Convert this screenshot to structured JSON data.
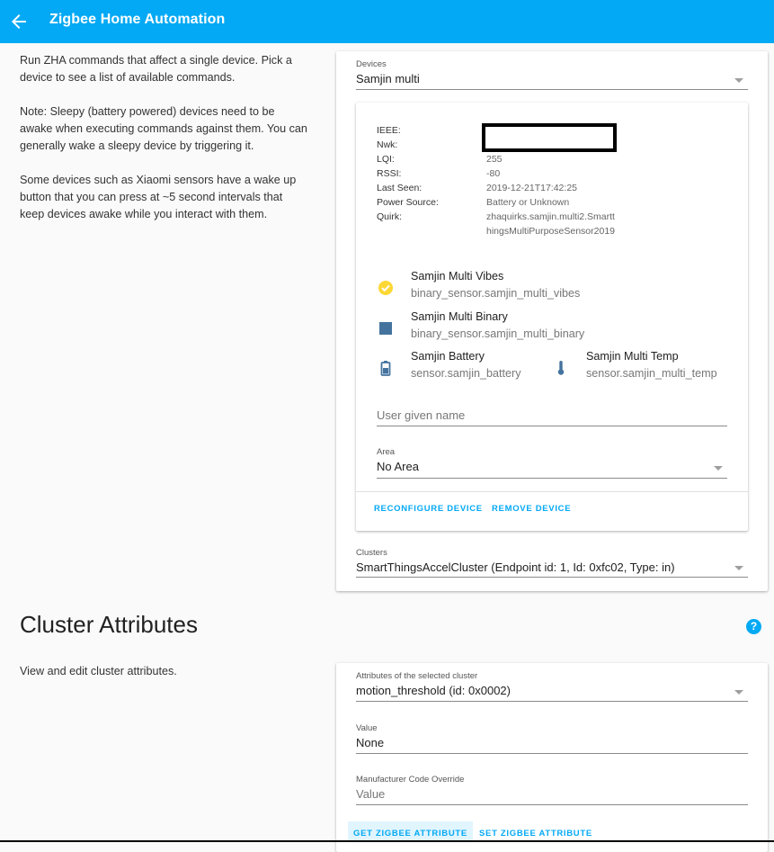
{
  "app": {
    "title": "Zigbee Home Automation",
    "accent": "#03a9f4"
  },
  "intro": {
    "p1": "Run ZHA commands that affect a single device. Pick a device to see a list of available commands.",
    "p2": "Note: Sleepy (battery powered) devices need to be awake when executing commands against them. You can generally wake a sleepy device by triggering it.",
    "p3": "Some devices such as Xiaomi sensors have a wake up button that you can press at ~5 second intervals that keep devices awake while you interact with them."
  },
  "devices": {
    "label": "Devices",
    "selected": "Samjin multi"
  },
  "device_info": {
    "rows": [
      {
        "key": "IEEE:",
        "value": ""
      },
      {
        "key": "Nwk:",
        "value": ""
      },
      {
        "key": "LQI:",
        "value": "255"
      },
      {
        "key": "RSSI:",
        "value": "-80"
      },
      {
        "key": "Last Seen:",
        "value": "2019-12-21T17:42:25"
      },
      {
        "key": "Power Source:",
        "value": "Battery or Unknown"
      },
      {
        "key": "Quirk:",
        "value": "zhaquirks.samjin.multi2.Smartt"
      },
      {
        "key": "",
        "value": "hingsMultiPurposeSensor2019"
      }
    ]
  },
  "entities": [
    {
      "name": "Samjin Multi Vibes",
      "id": "binary_sensor.samjin_multi_vibes",
      "icon": "check-circle-icon",
      "color": "#fdd835"
    },
    {
      "name": "Samjin Multi Binary",
      "id": "binary_sensor.samjin_multi_binary",
      "icon": "square-icon",
      "color": "#44739e"
    },
    {
      "name": "Samjin Battery",
      "id": "sensor.samjin_battery",
      "icon": "battery-icon",
      "color": "#44739e"
    },
    {
      "name": "Samjin Multi Temp",
      "id": "sensor.samjin_multi_temp",
      "icon": "thermometer-icon",
      "color": "#44739e"
    }
  ],
  "user_name": {
    "placeholder": "User given name"
  },
  "area": {
    "label": "Area",
    "selected": "No Area"
  },
  "actions": {
    "reconfigure": "RECONFIGURE DEVICE",
    "remove": "REMOVE DEVICE"
  },
  "clusters": {
    "label": "Clusters",
    "selected": "SmartThingsAccelCluster (Endpoint id: 1, Id: 0xfc02, Type: in)"
  },
  "cluster_attributes": {
    "title": "Cluster Attributes",
    "description": "View and edit cluster attributes.",
    "help": "?",
    "attr_label": "Attributes of the selected cluster",
    "attr_selected": "motion_threshold (id: 0x0002)",
    "value_label": "Value",
    "value": "None",
    "manufacturer_label": "Manufacturer Code Override",
    "manufacturer_placeholder": "Value",
    "get_button": "GET ZIGBEE ATTRIBUTE",
    "set_button": "SET ZIGBEE ATTRIBUTE"
  }
}
